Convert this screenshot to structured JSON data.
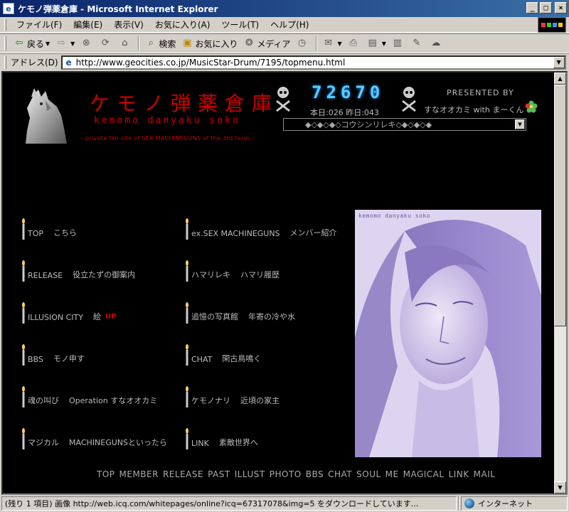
{
  "window": {
    "title": "ケモノ弾薬倉庫 - Microsoft Internet Explorer",
    "minimize": "_",
    "maximize": "□",
    "close": "×"
  },
  "menu": [
    "ファイル(F)",
    "編集(E)",
    "表示(V)",
    "お気に入り(A)",
    "ツール(T)",
    "ヘルプ(H)"
  ],
  "toolbar": {
    "back": "戻る",
    "search": "検索",
    "favorites": "お気に入り",
    "media": "メディア"
  },
  "address": {
    "label": "アドレス(D)",
    "url": "http://www.geocities.co.jp/MusicStar-Drum/7195/topmenu.html"
  },
  "page": {
    "title": "ケモノ弾薬倉庫",
    "romaji": "kemomo danyaku soko",
    "subtitle": "- private fan site of SEX MACHINEGUNS of the 3rd term -",
    "counter": "72670",
    "today_yesterday": "本日:026 昨日:043",
    "presented_by": "PRESENTED BY",
    "presenter": "すなオオカミ with まーくん",
    "jump_select": "◆◇◆◇◆◇コウシンリレキ◇◆◇◆◇◆",
    "portrait_caption": "kemomo danyaku soko",
    "links_left": [
      {
        "label": "TOP",
        "desc": "こちら"
      },
      {
        "label": "RELEASE",
        "desc": "役立たずの御案内"
      },
      {
        "label": "ILLUSION CITY",
        "desc": "絵"
      },
      {
        "label": "BBS",
        "desc": "モノ申す"
      },
      {
        "label": "魂の叫び",
        "desc": "Operation すなオオカミ"
      },
      {
        "label": "マジカル",
        "desc": "MACHINEGUNSといったら"
      }
    ],
    "new_badge": "UP",
    "links_right": [
      {
        "label": "ex.SEX MACHINEGUNS",
        "desc": "メンバー紹介"
      },
      {
        "label": "ハマリレキ",
        "desc": "ハマリ履歴"
      },
      {
        "label": "追憶の写真館",
        "desc": "年寄の冷や水"
      },
      {
        "label": "CHAT",
        "desc": "閑古鳥鳴く"
      },
      {
        "label": "ケモノナリ",
        "desc": "近頃の家主"
      },
      {
        "label": "LINK",
        "desc": "素敵世界へ"
      }
    ],
    "bottom_nav": [
      "TOP",
      "MEMBER",
      "RELEASE",
      "PAST",
      "ILLUST",
      "PHOTO",
      "BBS",
      "CHAT",
      "SOUL",
      "ME",
      "MAGICAL",
      "LINK",
      "MAIL"
    ]
  },
  "status": {
    "text": "(残り 1 項目) 画像 http://web.icq.com/whitepages/online?icq=67317078&img=5 をダウンロードしています...",
    "zone": "インターネット"
  },
  "colors": {
    "title_red": "#cc0000",
    "counter_cyan": "#55ccff",
    "page_bg": "#000000"
  }
}
